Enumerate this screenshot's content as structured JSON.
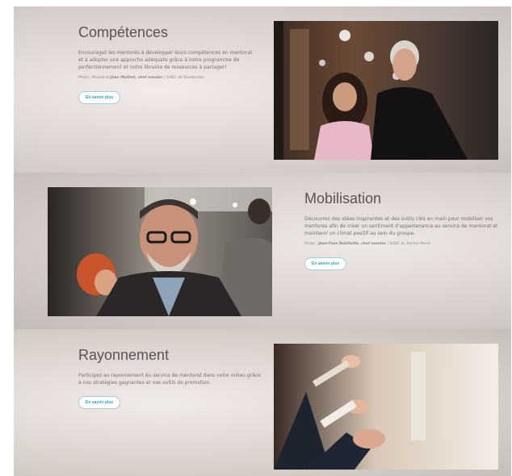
{
  "sections": [
    {
      "title": "Compétences",
      "description": "Encouragez les mentorés à développer leurs compétences en mentorat et à adopter une approche adéquate grâce à notre programme de perfectionnement et notre librairie de ressources à partager!",
      "credit_prefix": "Photo : Mouda et",
      "credit_names": "Jean Mathot, chef mentor",
      "credit_suffix": "| SADC de Sherbrooke",
      "button": "En savoir plus",
      "image_alt": "Two smiling people standing in front of a shop window"
    },
    {
      "title": "Mobilisation",
      "description": "Découvrez des idées inspirantes et des outils clés en main pour mobiliser vos mentorés afin de créer un sentiment d'appartenance au service de mentorat et maintenir un climat positif au sein du groupe.",
      "credit_prefix": "Photo :",
      "credit_names": "Jean-Yves Robitaille, chef mentor",
      "credit_suffix": "| SADC du Rocher-Percé",
      "button": "En savoir plus",
      "image_alt": "Smiling bearded man with glasses at an event"
    },
    {
      "title": "Rayonnement",
      "description": "Participez au rayonnement du service de mentorat dans votre milieu grâce à nos stratégies gagnantes et nos outils de promotion.",
      "button": "En savoir plus",
      "image_alt": "People applauding"
    }
  ]
}
